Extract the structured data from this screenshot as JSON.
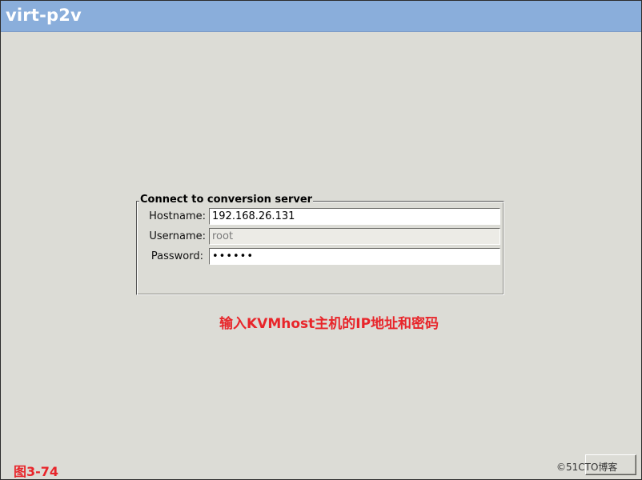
{
  "window": {
    "title": "virt-p2v"
  },
  "connection": {
    "group_title": "Connect to conversion server",
    "hostname_label": "Hostname:",
    "hostname_value": "192.168.26.131",
    "username_label": "Username:",
    "username_value": "root",
    "password_label": "Password:",
    "password_value": "••••••"
  },
  "annotation": {
    "text": "输入KVMhost主机的IP地址和密码"
  },
  "figure": {
    "label": "图3-74"
  },
  "watermark": {
    "text": "©51CTO博客"
  },
  "colors": {
    "titlebar": "#8aaedb",
    "annotation": "#e8252a",
    "background": "#dcdcd6"
  }
}
